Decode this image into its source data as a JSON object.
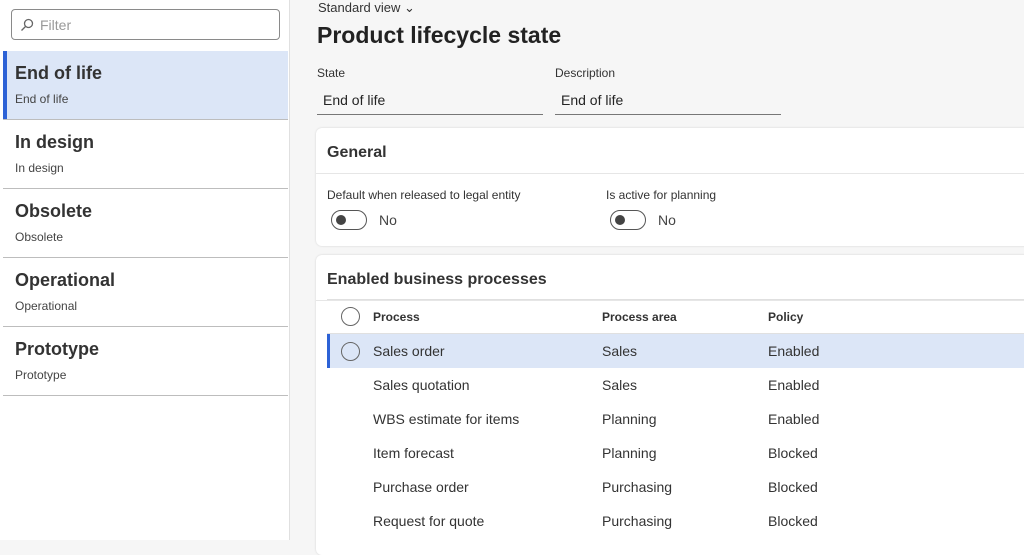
{
  "filter": {
    "placeholder": "Filter"
  },
  "states": [
    {
      "title": "End of life",
      "subtitle": "End of life"
    },
    {
      "title": "In design",
      "subtitle": "In design"
    },
    {
      "title": "Obsolete",
      "subtitle": "Obsolete"
    },
    {
      "title": "Operational",
      "subtitle": "Operational"
    },
    {
      "title": "Prototype",
      "subtitle": "Prototype"
    }
  ],
  "header": {
    "view": "Standard view",
    "title": "Product lifecycle state"
  },
  "fields": {
    "state_label": "State",
    "state_value": "End of life",
    "desc_label": "Description",
    "desc_value": "End of life"
  },
  "general": {
    "title": "General",
    "default_label": "Default when released to legal entity",
    "default_value": "No",
    "planning_label": "Is active for planning",
    "planning_value": "No"
  },
  "processes": {
    "title": "Enabled business processes",
    "columns": [
      "Process",
      "Process area",
      "Policy"
    ],
    "rows": [
      [
        "Sales order",
        "Sales",
        "Enabled"
      ],
      [
        "Sales quotation",
        "Sales",
        "Enabled"
      ],
      [
        "WBS estimate for items",
        "Planning",
        "Enabled"
      ],
      [
        "Item forecast",
        "Planning",
        "Blocked"
      ],
      [
        "Purchase order",
        "Purchasing",
        "Blocked"
      ],
      [
        "Request for quote",
        "Purchasing",
        "Blocked"
      ]
    ]
  },
  "colors": {
    "accent": "#2d62d6",
    "selected": "#dce6f7"
  }
}
